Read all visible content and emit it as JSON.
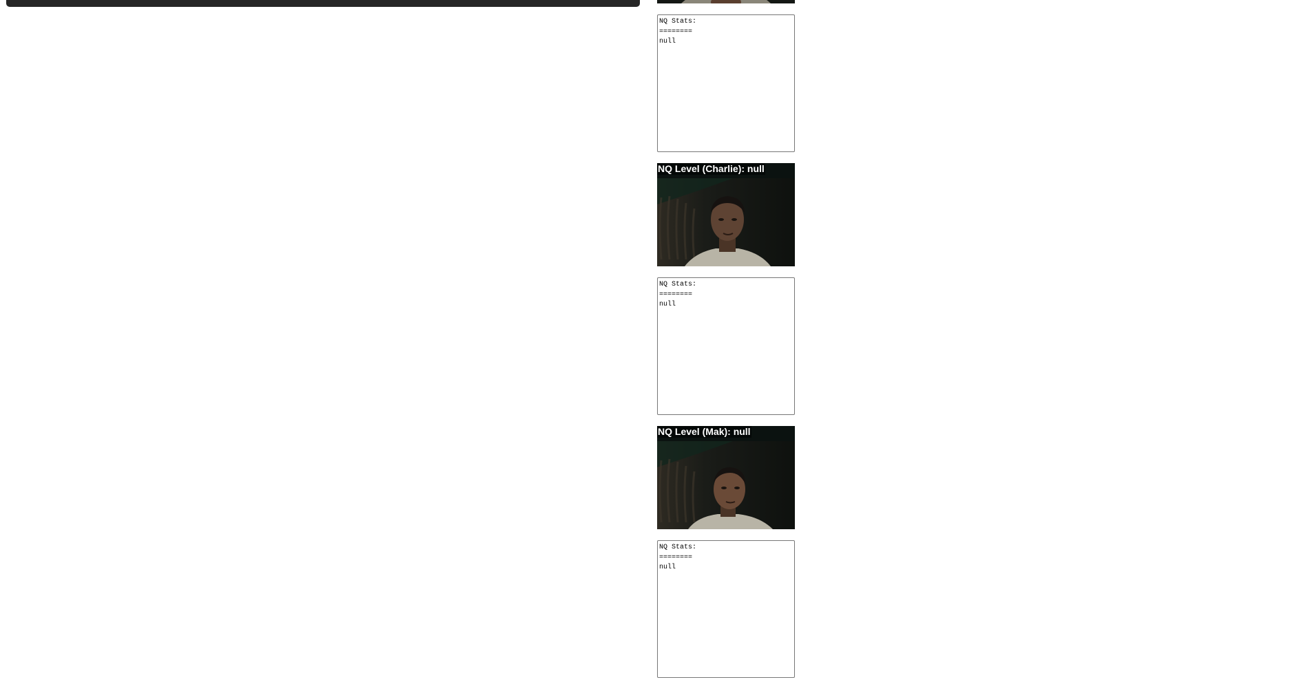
{
  "participants": [
    {
      "level_label": "",
      "stats": {
        "heading": "NQ Stats:",
        "rule": "========",
        "value": "null"
      }
    },
    {
      "level_label": "NQ Level (Charlie): null",
      "stats": {
        "heading": "NQ Stats:",
        "rule": "========",
        "value": "null"
      }
    },
    {
      "level_label": "NQ Level (Mak): null",
      "stats": {
        "heading": "NQ Stats:",
        "rule": "========",
        "value": "null"
      }
    }
  ],
  "colors": {
    "top_bar": "#262626",
    "video_background": "#111511",
    "label_text": "#ffffff",
    "stats_border": "#767676"
  }
}
